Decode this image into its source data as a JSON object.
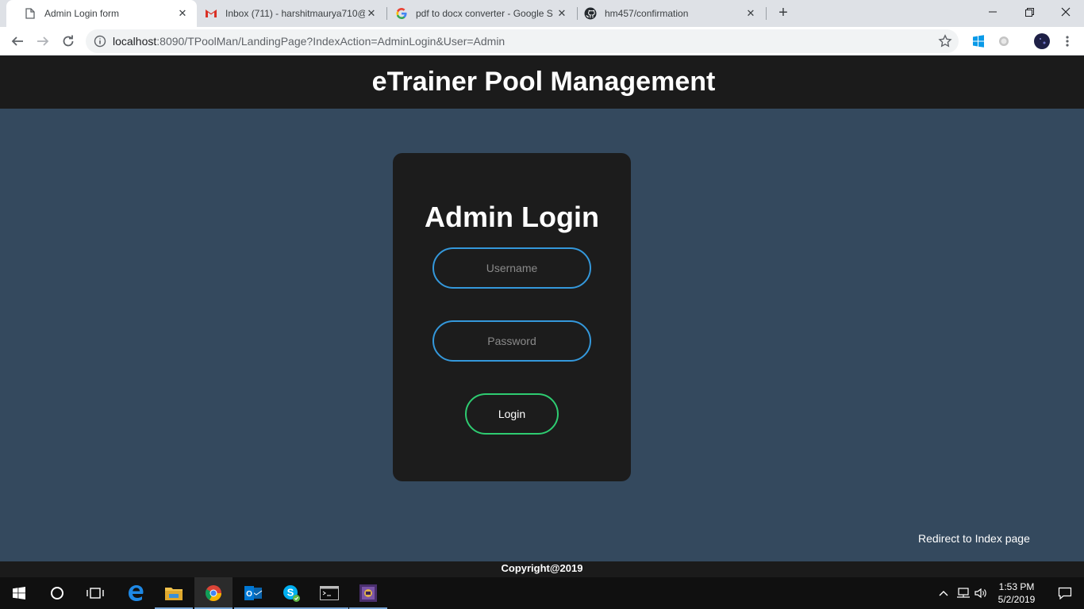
{
  "browser": {
    "tabs": [
      {
        "title": "Admin Login form",
        "icon": "document-icon",
        "active": true
      },
      {
        "title": "Inbox (711) - harshitmaurya710@",
        "icon": "gmail-icon",
        "active": false
      },
      {
        "title": "pdf to docx converter - Google S",
        "icon": "google-icon",
        "active": false
      },
      {
        "title": "hm457/confirmation",
        "icon": "github-icon",
        "active": false
      }
    ],
    "url_host": "localhost",
    "url_path": ":8090/TPoolMan/LandingPage?IndexAction=AdminLogin&User=Admin"
  },
  "page": {
    "site_title": "eTrainer Pool Management",
    "login": {
      "title": "Admin Login",
      "username_placeholder": "Username",
      "password_placeholder": "Password",
      "button_label": "Login"
    },
    "redirect_link": "Redirect to Index page",
    "footer": "Copyright@2019"
  },
  "taskbar": {
    "time": "1:53 PM",
    "date": "5/2/2019"
  },
  "colors": {
    "page_background": "#34495e",
    "header_background": "#1b1b1b",
    "card_background": "#1c1c1c",
    "input_border": "#3498db",
    "button_border": "#2ecc71"
  }
}
